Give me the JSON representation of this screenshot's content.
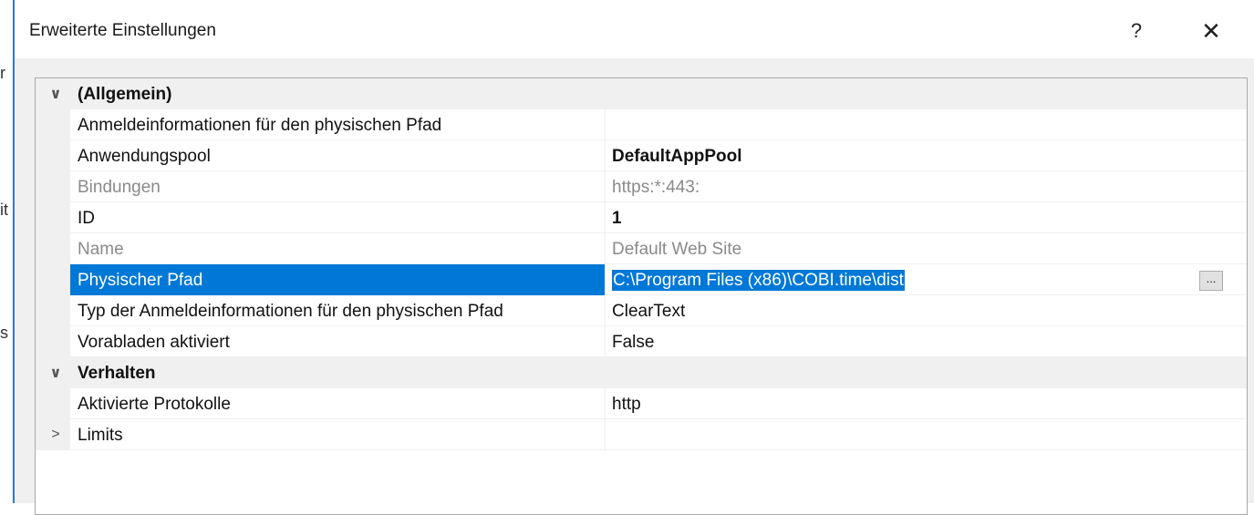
{
  "dialog": {
    "title": "Erweiterte Einstellungen",
    "help_label": "?",
    "close_label": "✕"
  },
  "sections": [
    {
      "label": "(Allgemein)",
      "expanded": true,
      "toggle_glyph": "∨",
      "properties": [
        {
          "name": "Anmeldeinformationen für den physischen Pfad",
          "value": ""
        },
        {
          "name": "Anwendungspool",
          "value": "DefaultAppPool",
          "bold": true
        },
        {
          "name": "Bindungen",
          "value": "https:*:443:",
          "readonly": true
        },
        {
          "name": "ID",
          "value": "1",
          "bold": true
        },
        {
          "name": "Name",
          "value": "Default Web Site",
          "readonly": true
        },
        {
          "name": "Physischer Pfad",
          "value": "C:\\Program Files (x86)\\COBI.time\\dist",
          "selected": true,
          "button": "..."
        },
        {
          "name": "Typ der Anmeldeinformationen für den physischen Pfad",
          "value": "ClearText"
        },
        {
          "name": "Vorabladen aktiviert",
          "value": "False"
        }
      ]
    },
    {
      "label": "Verhalten",
      "expanded": true,
      "toggle_glyph": "∨",
      "properties": [
        {
          "name": "Aktivierte Protokolle",
          "value": "http"
        },
        {
          "name": "Limits",
          "value": "",
          "collapsed_group": true,
          "toggle_glyph": ">"
        }
      ]
    }
  ],
  "left_strip_glyphs": [
    "r",
    "it",
    "s"
  ]
}
